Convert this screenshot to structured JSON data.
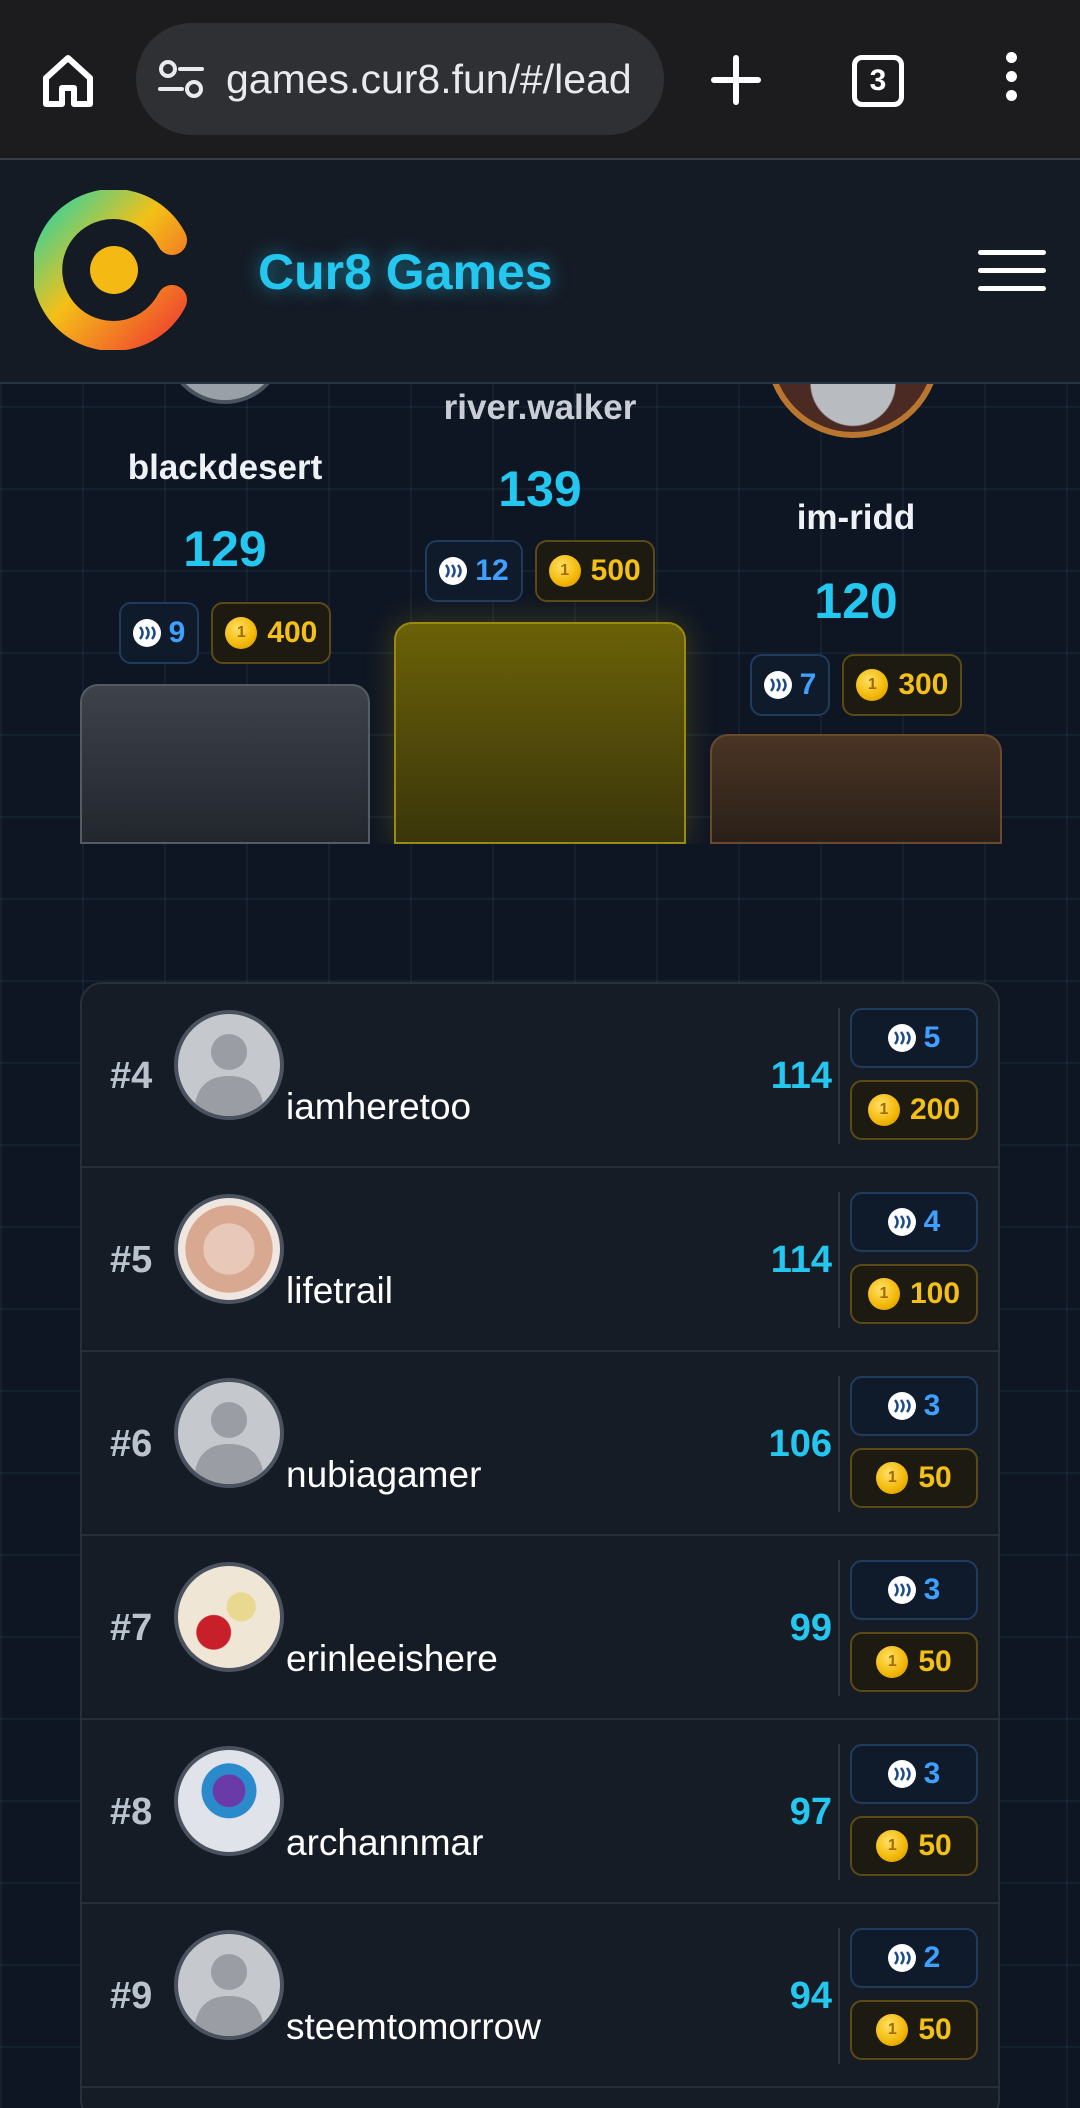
{
  "browser": {
    "url": "games.cur8.fun/#/lead",
    "tab_count": "3"
  },
  "header": {
    "title": "Cur8 Games"
  },
  "podium": [
    {
      "position": "second",
      "name": "blackdesert",
      "score": "129",
      "steem": "9",
      "coins": "400"
    },
    {
      "position": "first",
      "name": "river.walker",
      "score": "139",
      "steem": "12",
      "coins": "500"
    },
    {
      "position": "third",
      "name": "im-ridd",
      "score": "120",
      "steem": "7",
      "coins": "300"
    }
  ],
  "leaderboard": [
    {
      "rank": "#4",
      "name": "iamheretoo",
      "score": "114",
      "steem": "5",
      "coins": "200",
      "avatar": "default-avatar-icon"
    },
    {
      "rank": "#5",
      "name": "lifetrail",
      "score": "114",
      "steem": "4",
      "coins": "100",
      "avatar": "hands-photo-avatar"
    },
    {
      "rank": "#6",
      "name": "nubiagamer",
      "score": "106",
      "steem": "3",
      "coins": "50",
      "avatar": "default-avatar-icon"
    },
    {
      "rank": "#7",
      "name": "erinleeishere",
      "score": "99",
      "steem": "3",
      "coins": "50",
      "avatar": "strawberries-photo-avatar"
    },
    {
      "rank": "#8",
      "name": "archannmar",
      "score": "97",
      "steem": "3",
      "coins": "50",
      "avatar": "warrior-art-avatar"
    },
    {
      "rank": "#9",
      "name": "steemtomorrow",
      "score": "94",
      "steem": "2",
      "coins": "50",
      "avatar": "default-avatar-icon"
    }
  ],
  "colors": {
    "accent": "#23c7f0",
    "gold": "#f4c017",
    "steem_blue": "#3fa0ff",
    "background": "#0f1623"
  }
}
